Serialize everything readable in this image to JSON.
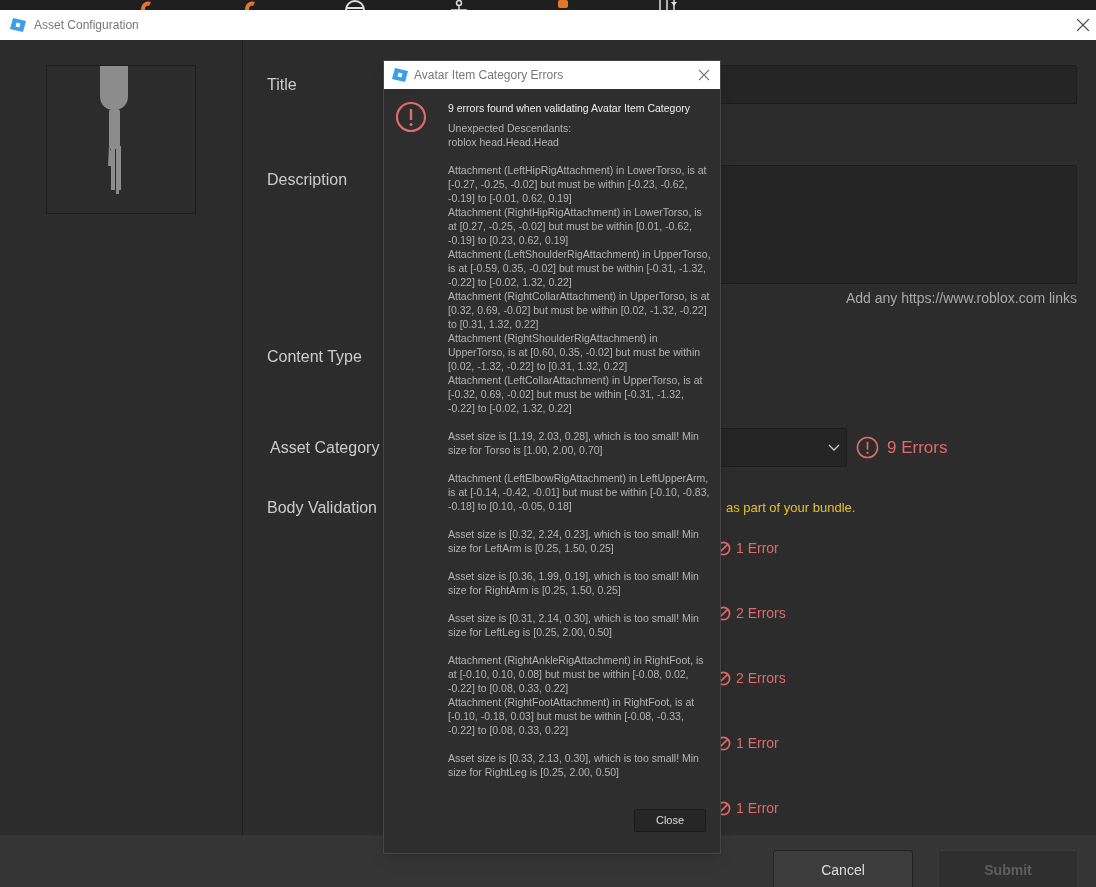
{
  "window": {
    "title": "Asset Configuration"
  },
  "toolbar": {
    "icons": [
      {
        "kind": "orange"
      },
      {
        "kind": "orange"
      },
      {
        "kind": "globe"
      },
      {
        "kind": "joint"
      },
      {
        "kind": "figure"
      },
      {
        "kind": "tool"
      }
    ]
  },
  "form": {
    "title_label": "Title",
    "description_label": "Description",
    "description_hint": "Add any https://www.roblox.com links",
    "content_type_label": "Content Type",
    "asset_category_label": "Asset Category",
    "asset_category_errors": "9 Errors",
    "body_validation_label": "Body Validation",
    "body_validation_note": "as part of your bundle.",
    "body_parts": [
      {
        "count": "1 Error"
      },
      {
        "count": "2 Errors"
      },
      {
        "count": "2 Errors"
      },
      {
        "count": "1 Error"
      },
      {
        "count": "1 Error"
      }
    ]
  },
  "dialog": {
    "title": "Avatar Item Category Errors",
    "heading": "9 errors found when validating Avatar Item Category",
    "blocks": [
      [
        "Unexpected Descendants:",
        "roblox head.Head.Head"
      ],
      [
        "Attachment (LeftHipRigAttachment) in LowerTorso, is at [-0.27, -0.25, -0.02] but must be within [-0.23, -0.62, -0.19] to [-0.01, 0.62, 0.19]",
        "Attachment (RightHipRigAttachment) in LowerTorso, is at [0.27, -0.25, -0.02] but must be within [0.01, -0.62, -0.19] to [0.23, 0.62, 0.19]",
        "Attachment (LeftShoulderRigAttachment) in UpperTorso, is at [-0.59, 0.35, -0.02] but must be within [-0.31, -1.32, -0.22] to [-0.02, 1.32, 0.22]",
        "Attachment (RightCollarAttachment) in UpperTorso, is at [0.32, 0.69, -0.02] but must be within [0.02, -1.32, -0.22] to [0.31, 1.32, 0.22]",
        "Attachment (RightShoulderRigAttachment) in UpperTorso, is at [0.60, 0.35, -0.02] but must be within [0.02, -1.32, -0.22] to [0.31, 1.32, 0.22]",
        "Attachment (LeftCollarAttachment) in UpperTorso, is at [-0.32, 0.69, -0.02] but must be within [-0.31, -1.32, -0.22] to [-0.02, 1.32, 0.22]"
      ],
      [
        "Asset size is [1.19, 2.03, 0.28], which is too small! Min size for Torso is [1.00, 2.00, 0.70]"
      ],
      [
        "Attachment (LeftElbowRigAttachment) in LeftUpperArm, is at [-0.14, -0.42, -0.01] but must be within [-0.10, -0.83, -0.18] to [0.10, -0.05, 0.18]"
      ],
      [
        "Asset size is [0.32, 2.24, 0.23], which is too small! Min size for LeftArm is [0.25, 1.50, 0.25]"
      ],
      [
        "Asset size is [0.36, 1.99, 0.19], which is too small! Min size for RightArm is [0.25, 1.50, 0.25]"
      ],
      [
        "Asset size is [0.31, 2.14, 0.30], which is too small! Min size for LeftLeg is [0.25, 2.00, 0.50]"
      ],
      [
        "Attachment (RightAnkleRigAttachment) in RightFoot, is at [-0.10, 0.10, 0.08] but must be within [-0.08, 0.02, -0.22] to [0.08, 0.33, 0.22]",
        "Attachment (RightFootAttachment) in RightFoot, is at [-0.10, -0.18, 0.03] but must be within [-0.08, -0.33, -0.22] to [0.08, 0.33, 0.22]"
      ],
      [
        "Asset size is [0.33, 2.13, 0.30], which is too small! Min size for RightLeg is [0.25, 2.00, 0.50]"
      ]
    ],
    "close_button": "Close"
  },
  "buttons": [
    {
      "label": "Cancel",
      "disabled": false
    },
    {
      "label": "Submit",
      "disabled": true
    }
  ]
}
